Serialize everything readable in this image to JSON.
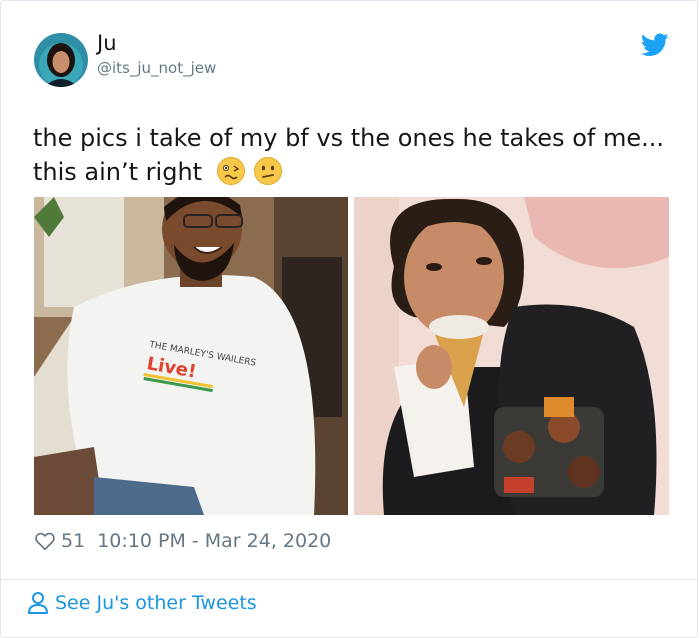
{
  "author": {
    "display_name": "Ju",
    "handle": "@its_ju_not_jew",
    "avatar_icon": "user-avatar"
  },
  "tweet": {
    "text": "the pics i take of my bf vs the ones he takes of me... this ain’t right",
    "emojis": [
      "woozy-face-emoji",
      "confused-face-emoji"
    ],
    "photos": [
      {
        "icon": "photo-boyfriend-smiling",
        "shirt_text": "Live!"
      },
      {
        "icon": "photo-girl-eating-ice-cream"
      }
    ]
  },
  "meta": {
    "likes": "51",
    "timestamp": "10:10 PM - Mar 24, 2020"
  },
  "footer": {
    "link_label": "See Ju's other Tweets"
  },
  "colors": {
    "brand": "#1da1f2",
    "link": "#1b95e0",
    "text": "#14171a",
    "muted": "#657786",
    "border": "#e1e8ed"
  }
}
